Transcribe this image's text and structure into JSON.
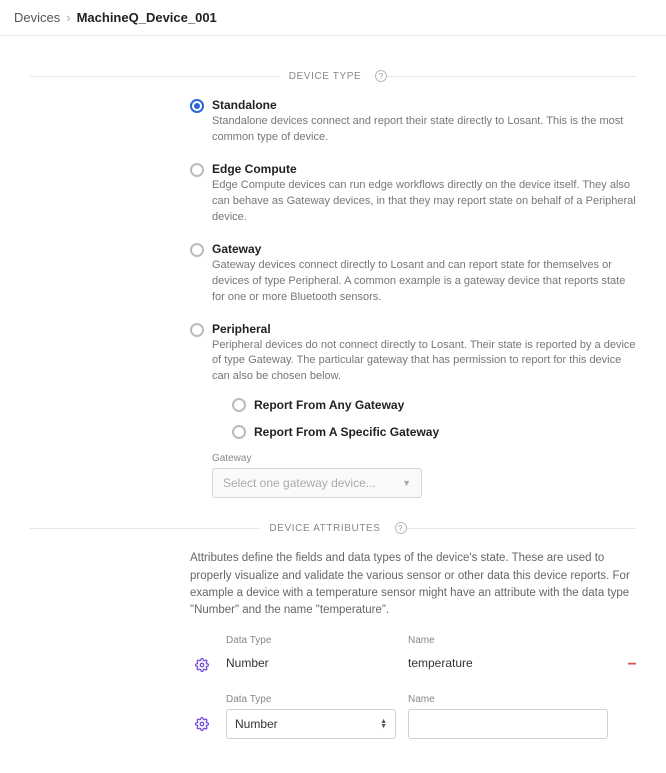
{
  "breadcrumb": {
    "root": "Devices",
    "current": "MachineQ_Device_001"
  },
  "sections": {
    "device_type": {
      "title": "DEVICE TYPE",
      "options": {
        "standalone": {
          "title": "Standalone",
          "desc": "Standalone devices connect and report their state directly to Losant. This is the most common type of device."
        },
        "edge": {
          "title": "Edge Compute",
          "desc": "Edge Compute devices can run edge workflows directly on the device itself. They also can behave as Gateway devices, in that they may report state on behalf of a Peripheral device."
        },
        "gateway": {
          "title": "Gateway",
          "desc": "Gateway devices connect directly to Losant and can report state for themselves or devices of type Peripheral. A common example is a gateway device that reports state for one or more Bluetooth sensors."
        },
        "peripheral": {
          "title": "Peripheral",
          "desc": "Peripheral devices do not connect directly to Losant. Their state is reported by a device of type Gateway. The particular gateway that has permission to report for this device can also be chosen below.",
          "sub": {
            "any": "Report From Any Gateway",
            "specific": "Report From A Specific Gateway"
          },
          "gateway_label": "Gateway",
          "gateway_placeholder": "Select one gateway device..."
        }
      }
    },
    "device_attributes": {
      "title": "DEVICE ATTRIBUTES",
      "desc": "Attributes define the fields and data types of the device's state. These are used to properly visualize and validate the various sensor or other data this device reports. For example a device with a temperature sensor might have an attribute with the data type \"Number\" and the name \"temperature\".",
      "columns": {
        "datatype": "Data Type",
        "name": "Name"
      },
      "rows": [
        {
          "datatype": "Number",
          "name": "temperature"
        },
        {
          "datatype": "Number",
          "name": ""
        }
      ]
    }
  }
}
